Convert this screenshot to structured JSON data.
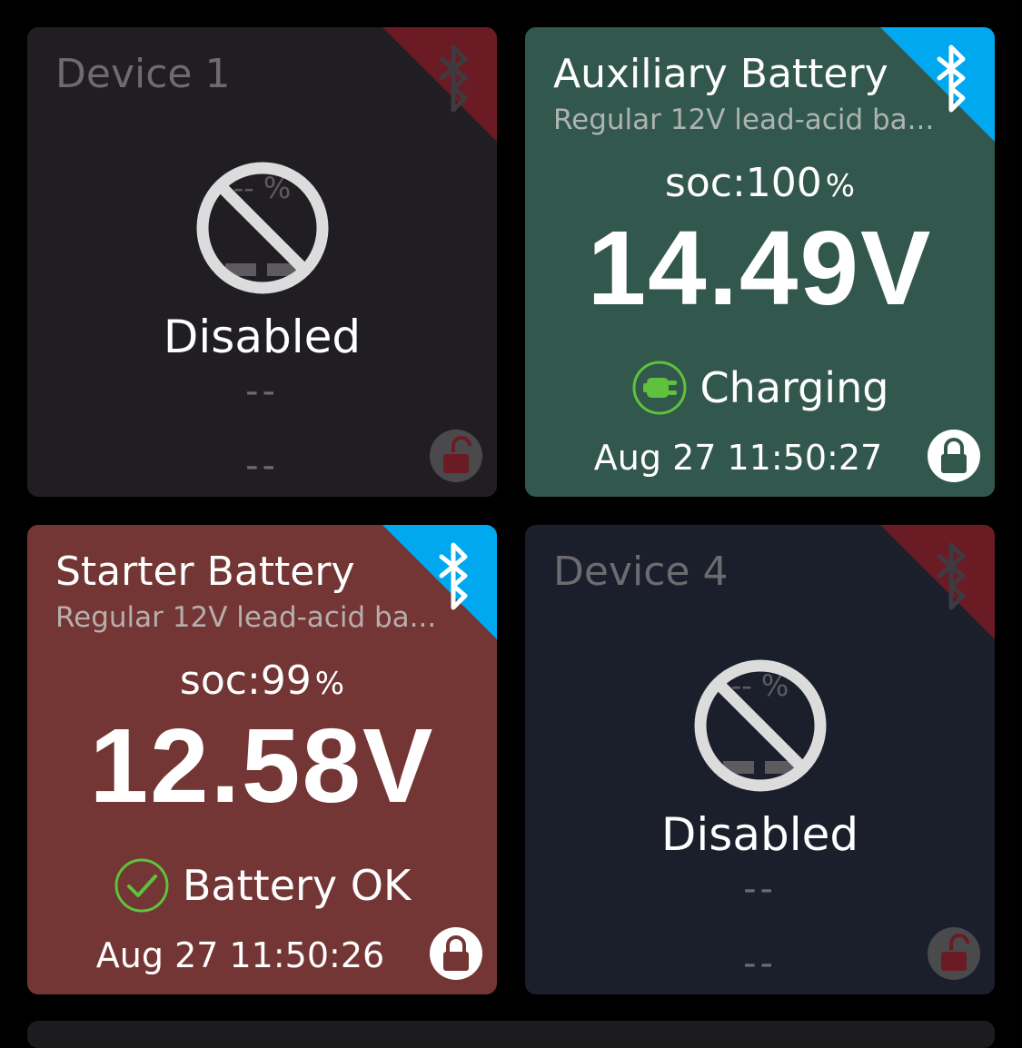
{
  "colors": {
    "page_bg": "#000000",
    "disabled_card_1": "#201e23",
    "aux_card": "#32574d",
    "starter_card": "#733634",
    "disabled_card_4": "#1a1f2b",
    "bt_connected": "#00a8ef",
    "bt_disconnected": "#6b1b24",
    "status_green": "#5ec23c"
  },
  "cards": [
    {
      "name": "Device 1",
      "state": "Disabled",
      "soc": "-- %",
      "detail_1": "--",
      "detail_2": "--",
      "bluetooth_icon": "bluetooth-disconnected-icon",
      "lock_icon": "unlocked-icon"
    },
    {
      "name": "Auxiliary Battery",
      "subtitle": "Regular 12V lead-acid ba...",
      "soc_label": "soc:100",
      "soc_unit": "%",
      "voltage": "14.49V",
      "status": "Charging",
      "status_icon": "charging-plug-icon",
      "timestamp": "Aug 27 11:50:27",
      "bluetooth_icon": "bluetooth-connected-icon",
      "lock_icon": "locked-icon"
    },
    {
      "name": "Starter Battery",
      "subtitle": "Regular 12V lead-acid ba...",
      "soc_label": "soc:99",
      "soc_unit": "%",
      "voltage": "12.58V",
      "status": "Battery OK",
      "status_icon": "check-circle-icon",
      "timestamp": "Aug 27 11:50:26",
      "bluetooth_icon": "bluetooth-connected-icon",
      "lock_icon": "locked-icon"
    },
    {
      "name": "Device 4",
      "state": "Disabled",
      "soc": "-- %",
      "detail_1": "--",
      "detail_2": "--",
      "bluetooth_icon": "bluetooth-disconnected-icon",
      "lock_icon": "unlocked-icon"
    }
  ]
}
